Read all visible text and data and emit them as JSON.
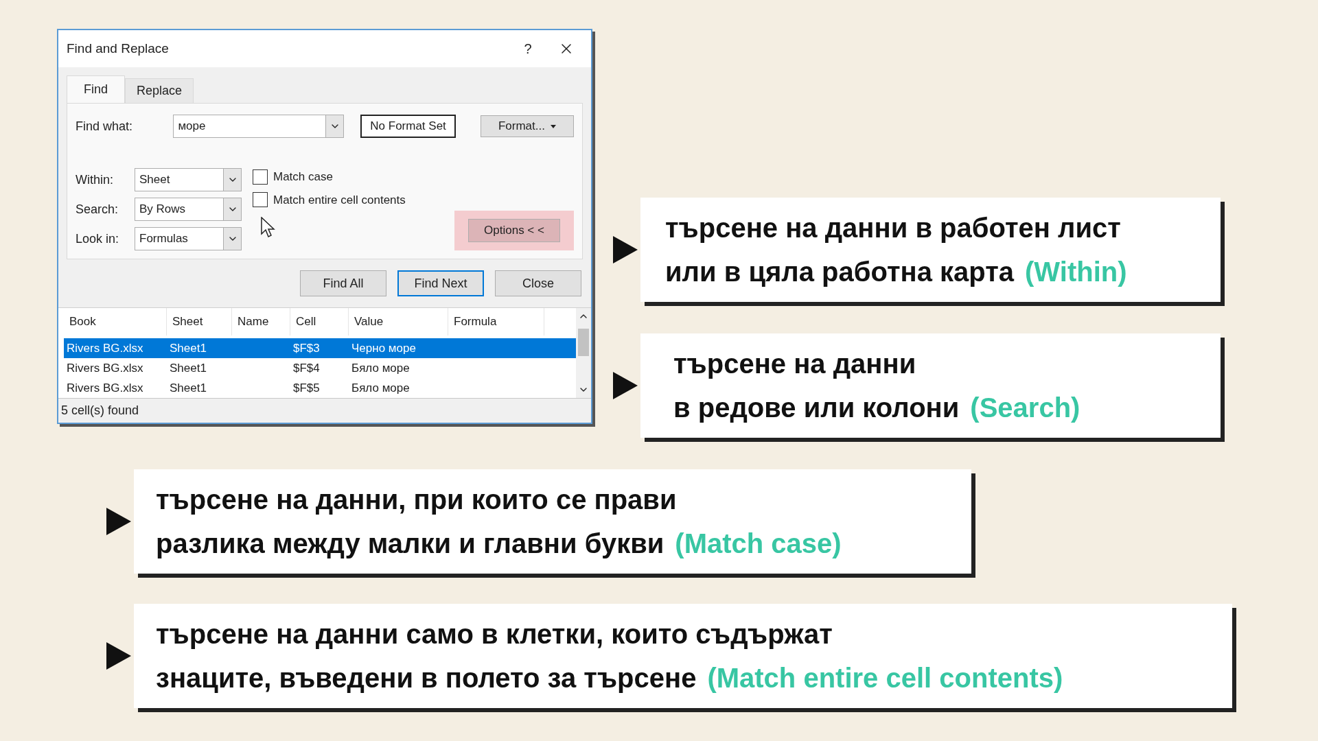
{
  "dialog": {
    "title": "Find and Replace",
    "help": "?",
    "tabs": [
      {
        "label": "Find",
        "selected": true
      },
      {
        "label": "Replace",
        "selected": false
      }
    ],
    "find_what": {
      "label": "Find what:",
      "value": "море"
    },
    "format_preview": "No Format Set",
    "format_button": "Format...",
    "options": [
      {
        "label": "Within:",
        "value": "Sheet"
      },
      {
        "label": "Search:",
        "value": "By Rows"
      },
      {
        "label": "Look in:",
        "value": "Formulas"
      }
    ],
    "checkboxes": [
      {
        "label": "Match case",
        "checked": false
      },
      {
        "label": "Match entire cell contents",
        "checked": false
      }
    ],
    "options_button": {
      "label": "Options < <",
      "highlighted": true
    },
    "buttons": [
      {
        "label": "Find All",
        "default": false
      },
      {
        "label": "Find Next",
        "default": true
      },
      {
        "label": "Close",
        "default": false
      }
    ],
    "results": {
      "columns": [
        "Book",
        "Sheet",
        "Name",
        "Cell",
        "Value",
        "Formula"
      ],
      "rows": [
        {
          "cells": [
            "Rivers BG.xlsx",
            "Sheet1",
            "",
            "$F$3",
            "Черно море",
            ""
          ],
          "selected": true
        },
        {
          "cells": [
            "Rivers BG.xlsx",
            "Sheet1",
            "",
            "$F$4",
            "Бяло море",
            ""
          ],
          "selected": false
        },
        {
          "cells": [
            "Rivers BG.xlsx",
            "Sheet1",
            "",
            "$F$5",
            "Бяло море",
            ""
          ],
          "selected": false
        }
      ]
    },
    "status": "5 cell(s) found"
  },
  "callouts": [
    {
      "lines": [
        "търсене на данни в работен лист",
        "или в цяла работна карта"
      ],
      "tag": "(Within)"
    },
    {
      "lines": [
        "търсене на данни",
        "в редове или колони"
      ],
      "tag": "(Search)"
    },
    {
      "lines": [
        "търсене на данни, при които се прави",
        "разлика между малки и главни букви"
      ],
      "tag": "(Match case)"
    },
    {
      "lines": [
        "търсене на данни само в клетки, които съдържат",
        "знаците, въведени в полето за търсене"
      ],
      "tag": "(Match entire cell contents)"
    }
  ]
}
